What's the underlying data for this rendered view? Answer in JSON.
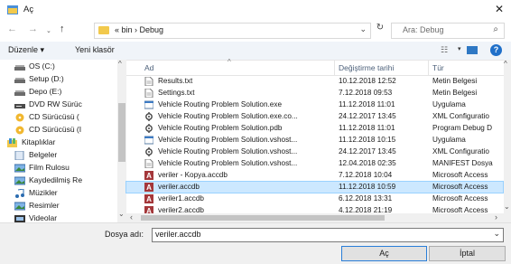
{
  "window": {
    "title": "Aç",
    "close_glyph": "✕"
  },
  "nav": {
    "back": "←",
    "forward": "→",
    "up": "↑",
    "address": "« bin › Debug",
    "address_chevron": "⌄",
    "refresh": "↻",
    "search_placeholder": "Ara: Debug",
    "search_glyph": "⌕"
  },
  "toolbar": {
    "organize": "Düzenle ▾",
    "new_folder": "Yeni klasör",
    "view_glyph": "☷",
    "caret": "▾",
    "help": "?"
  },
  "sidebar": {
    "items": [
      {
        "label": "OS (C:)",
        "icon": "drive-icon",
        "indent": 1
      },
      {
        "label": "Setup (D:)",
        "icon": "drive-icon",
        "indent": 1
      },
      {
        "label": "Depo (E:)",
        "icon": "drive-icon",
        "indent": 1
      },
      {
        "label": "DVD RW Sürüc",
        "icon": "dvd-drive-icon",
        "indent": 1
      },
      {
        "label": "CD Sürücüsü (",
        "icon": "cd-drive-icon",
        "indent": 1
      },
      {
        "label": "CD Sürücüsü (I",
        "icon": "cd-drive-icon",
        "indent": 1
      },
      {
        "label": "Kitaplıklar",
        "icon": "libraries-icon",
        "indent": 0
      },
      {
        "label": "Belgeler",
        "icon": "documents-icon",
        "indent": 1
      },
      {
        "label": "Film Rulosu",
        "icon": "camera-roll-icon",
        "indent": 1
      },
      {
        "label": "Kaydedilmiş Re",
        "icon": "saved-pictures-icon",
        "indent": 1
      },
      {
        "label": "Müzikler",
        "icon": "music-icon",
        "indent": 1
      },
      {
        "label": "Resimler",
        "icon": "pictures-icon",
        "indent": 1
      },
      {
        "label": "Videolar",
        "icon": "videos-icon",
        "indent": 1
      }
    ]
  },
  "columns": {
    "name": "Ad",
    "date": "Değiştirme tarihi",
    "type": "Tür",
    "sort_glyph": "^"
  },
  "files": [
    {
      "name": "Results.txt",
      "date": "10.12.2018 12:52",
      "type": "Metin Belgesi",
      "icon": "text-file-icon"
    },
    {
      "name": "Settings.txt",
      "date": "7.12.2018 09:53",
      "type": "Metin Belgesi",
      "icon": "text-file-icon"
    },
    {
      "name": "Vehicle Routing Problem Solution.exe",
      "date": "11.12.2018 11:01",
      "type": "Uygulama",
      "icon": "exe-icon"
    },
    {
      "name": "Vehicle Routing Problem Solution.exe.co...",
      "date": "24.12.2017 13:45",
      "type": "XML Configuratio",
      "icon": "config-icon"
    },
    {
      "name": "Vehicle Routing Problem Solution.pdb",
      "date": "11.12.2018 11:01",
      "type": "Program Debug D",
      "icon": "pdb-icon"
    },
    {
      "name": "Vehicle Routing Problem Solution.vshost...",
      "date": "11.12.2018 10:15",
      "type": "Uygulama",
      "icon": "exe-icon"
    },
    {
      "name": "Vehicle Routing Problem Solution.vshost...",
      "date": "24.12.2017 13:45",
      "type": "XML Configuratio",
      "icon": "config-icon"
    },
    {
      "name": "Vehicle Routing Problem Solution.vshost...",
      "date": "12.04.2018 02:35",
      "type": "MANIFEST Dosya",
      "icon": "file-icon"
    },
    {
      "name": "veriler - Kopya.accdb",
      "date": "7.12.2018 10:04",
      "type": "Microsoft Access",
      "icon": "access-db-icon"
    },
    {
      "name": "veriler.accdb",
      "date": "11.12.2018 10:59",
      "type": "Microsoft Access",
      "icon": "access-db-icon",
      "selected": true
    },
    {
      "name": "veriler1.accdb",
      "date": "6.12.2018 13:31",
      "type": "Microsoft Access",
      "icon": "access-db-icon"
    },
    {
      "name": "veriler2.accdb",
      "date": "4.12.2018 21:19",
      "type": "Microsoft Access",
      "icon": "access-db-icon"
    }
  ],
  "bottom": {
    "filename_label": "Dosya adı:",
    "filename_value": "veriler.accdb",
    "open_label": "Aç",
    "cancel_label": "İptal",
    "chevron": "⌄"
  },
  "scroll": {
    "left": "‹",
    "right": "›",
    "up": "^",
    "down": "⌄"
  },
  "colors": {
    "selection": "#cce8ff",
    "access_red": "#a4373a",
    "accent": "#1f6fc9"
  }
}
